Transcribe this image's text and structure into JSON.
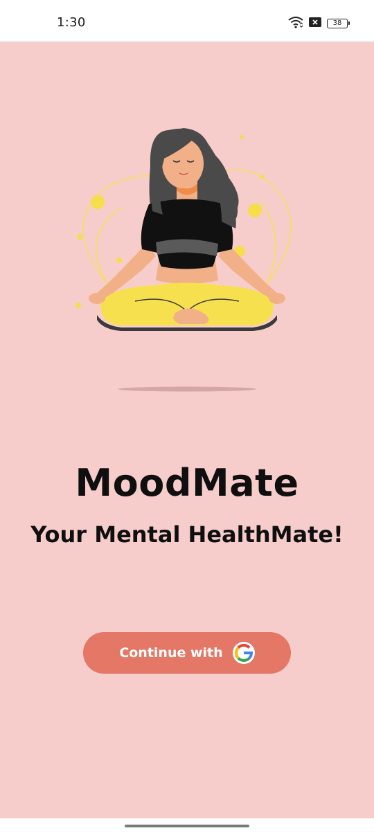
{
  "status_bar": {
    "time": "1:30",
    "battery_level": "38",
    "icons": [
      "wifi-icon",
      "notification-x-icon",
      "battery-icon"
    ]
  },
  "main": {
    "background_color": "#f6cdcb",
    "illustration": "meditating-woman-illustration",
    "title": "MoodMate",
    "tagline": "Your Mental HealthMate!",
    "continue_button": {
      "label": "Continue with",
      "icon": "google-icon",
      "color": "#e57766"
    }
  }
}
